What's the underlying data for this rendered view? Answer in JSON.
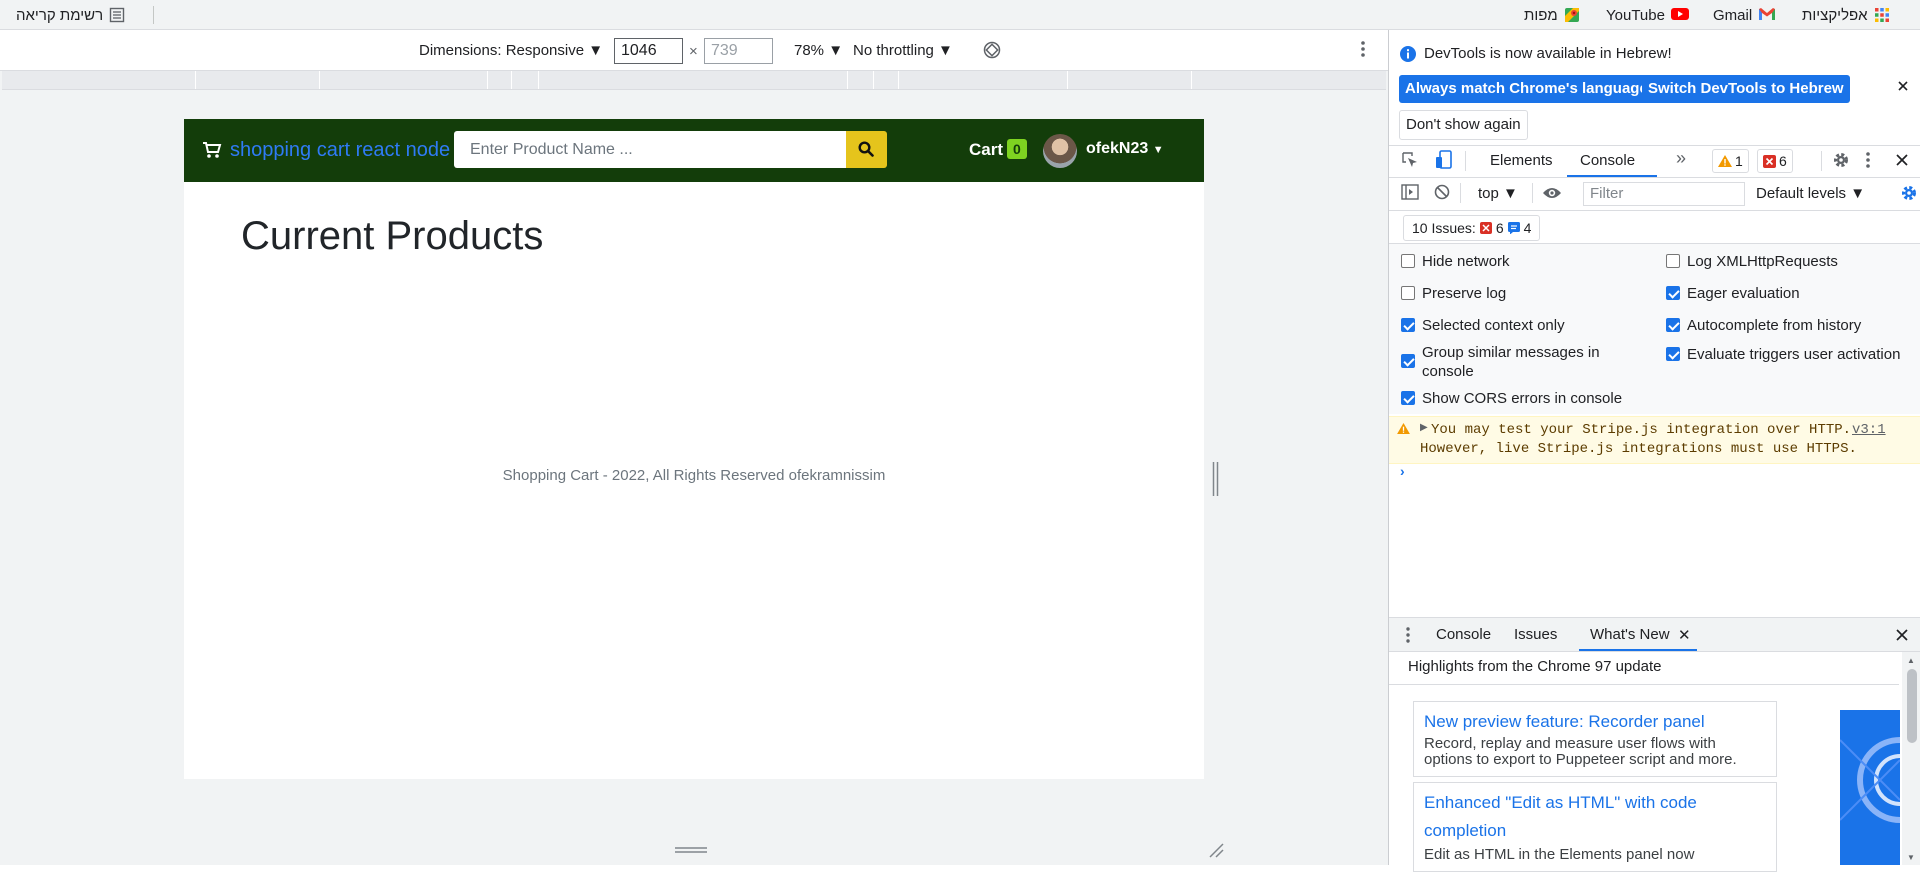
{
  "bookmarks": {
    "reading_list": "רשימת קריאה",
    "items": [
      {
        "label": "אפליקציות",
        "icon": "apps-grid-icon"
      },
      {
        "label": "Gmail",
        "icon": "gmail-icon"
      },
      {
        "label": "YouTube",
        "icon": "youtube-icon"
      },
      {
        "label": "מפות",
        "icon": "maps-icon"
      }
    ]
  },
  "device_toolbar": {
    "dimensions": "Dimensions: Responsive",
    "width": "1046",
    "times": "×",
    "height": "739",
    "zoom": "78%",
    "throttling": "No throttling"
  },
  "page": {
    "brand": "shopping cart react node",
    "search_placeholder": "Enter Product Name ...",
    "cart_label": "Cart",
    "cart_count": "0",
    "username": "ofekN23",
    "heading": "Current Products",
    "footer": "Shopping Cart - 2022, All Rights Reserved ofekramnissim"
  },
  "devtools": {
    "banner_text": "DevTools is now available in Hebrew!",
    "banner_btn_match": "Always match Chrome's language",
    "banner_btn_switch": "Switch DevTools to Hebrew",
    "banner_btn_dismiss": "Don't show again",
    "tabs": {
      "elements": "Elements",
      "console": "Console"
    },
    "warning_count": "1",
    "error_count": "6",
    "context": "top",
    "filter_placeholder": "Filter",
    "levels": "Default levels",
    "issues_label": "10 Issues:",
    "issues_errors": "6",
    "issues_info": "4",
    "settings": {
      "hide_network": "Hide network",
      "preserve_log": "Preserve log",
      "selected_context": "Selected context only",
      "group_similar": "Group similar messages in console",
      "show_cors": "Show CORS errors in console",
      "log_xhr": "Log XMLHttpRequests",
      "eager_eval": "Eager evaluation",
      "autocomplete": "Autocomplete from history",
      "eval_triggers": "Evaluate triggers user activation"
    },
    "warning_line1": "You may test your Stripe.js integration over HTTP.",
    "warning_link": "v3:1",
    "warning_line2": "However, live Stripe.js integrations must use HTTPS.",
    "drawer_tabs": {
      "console": "Console",
      "issues": "Issues",
      "whats_new": "What's New"
    },
    "whats_new_header": "Highlights from the Chrome 97 update",
    "cards": [
      {
        "title": "New preview feature: Recorder panel",
        "desc": "Record, replay and measure user flows with options to export to Puppeteer script and more."
      },
      {
        "title": "Enhanced \"Edit as HTML\" with code completion",
        "desc": "Edit as HTML in the Elements panel now"
      }
    ]
  }
}
